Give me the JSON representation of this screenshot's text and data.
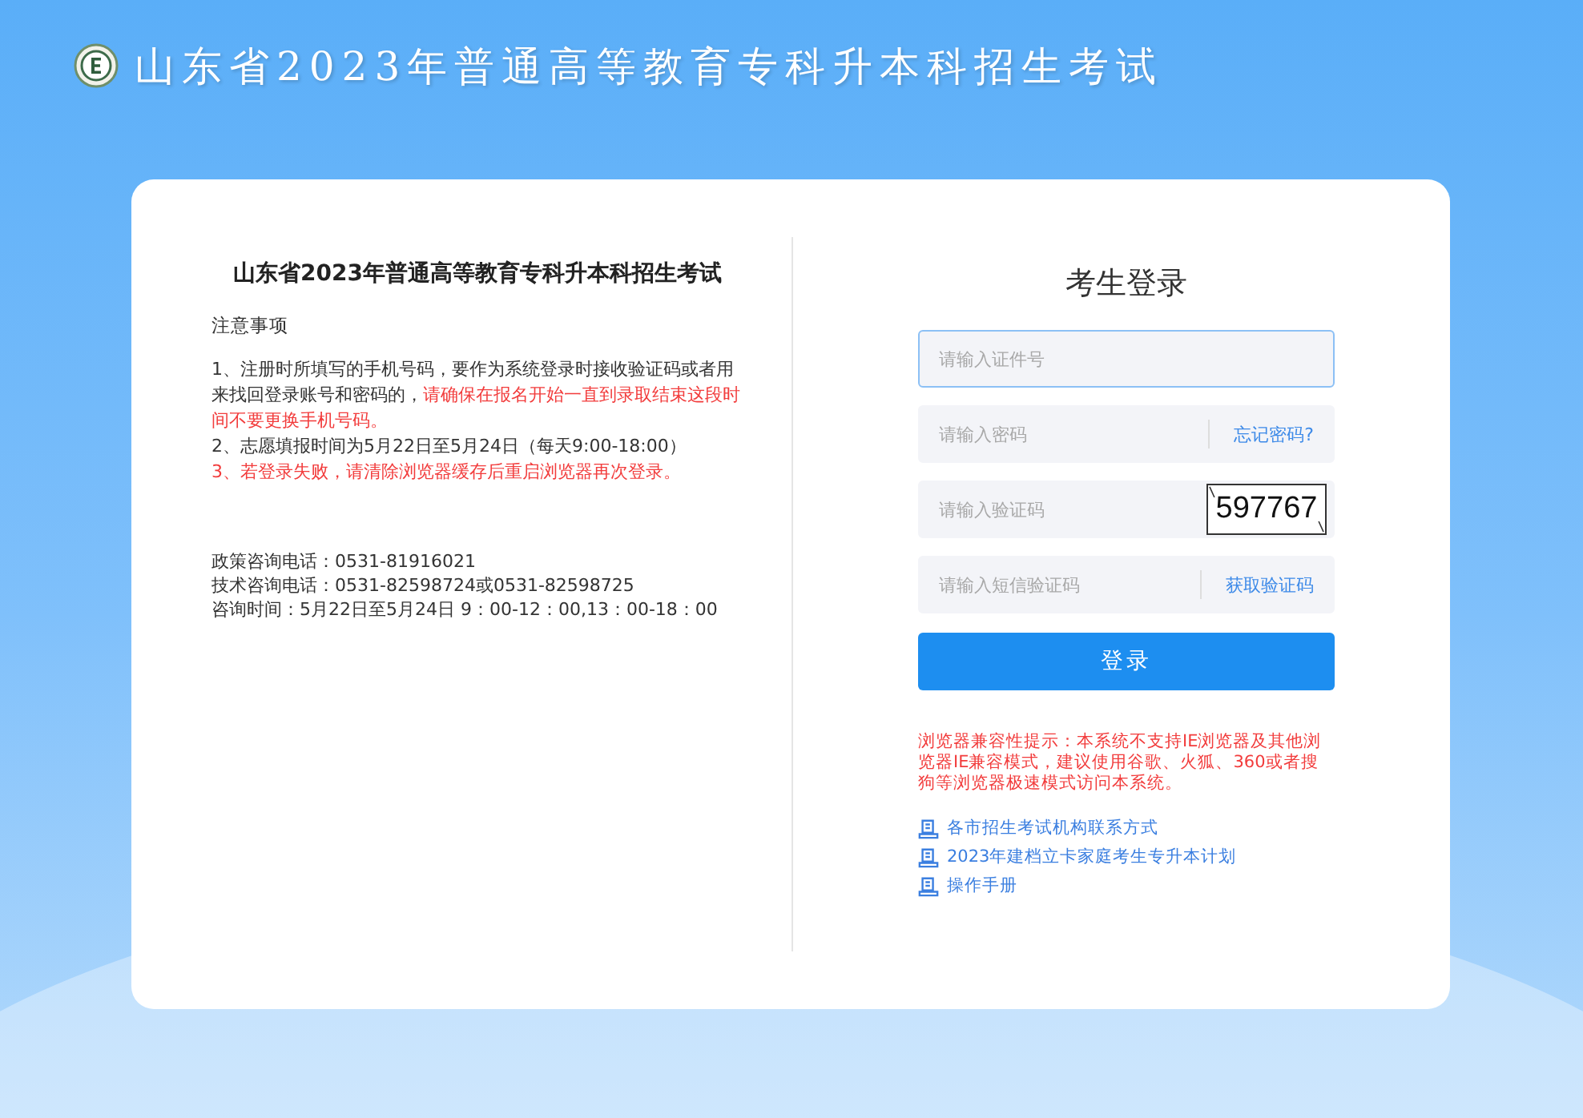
{
  "header": {
    "title": "山东省2023年普通高等教育专科升本科招生考试"
  },
  "notice": {
    "title": "山东省2023年普通高等教育专科升本科招生考试",
    "heading": "注意事项",
    "items": [
      {
        "segments": [
          {
            "text": "1、注册时所填写的手机号码，要作为系统登录时接收验证码或者用来找回登录账号和密码的，",
            "alert": false
          },
          {
            "text": "请确保在报名开始一直到录取结束这段时间不要更换手机号码。",
            "alert": true
          }
        ]
      },
      {
        "segments": [
          {
            "text": "2、志愿填报时间为5月22日至5月24日（每天9:00-18:00）",
            "alert": false
          }
        ]
      },
      {
        "segments": [
          {
            "text": "3、若登录失败，请清除浏览器缓存后重启浏览器再次登录。",
            "alert": true
          }
        ]
      }
    ],
    "contacts": [
      "政策咨询电话：0531-81916021",
      "技术咨询电话：0531-82598724或0531-82598725",
      "咨询时间：5月22日至5月24日 9：00-12：00,13：00-18：00"
    ]
  },
  "login": {
    "title": "考生登录",
    "fields": [
      {
        "kind": "plain",
        "placeholder": "请输入证件号",
        "focused": true
      },
      {
        "kind": "link",
        "placeholder": "请输入密码",
        "focused": false,
        "action": "忘记密码?"
      },
      {
        "kind": "captcha",
        "placeholder": "请输入验证码",
        "focused": false,
        "captcha": "597767"
      },
      {
        "kind": "link",
        "placeholder": "请输入短信验证码",
        "focused": false,
        "action": "获取验证码"
      }
    ],
    "submit": "登录",
    "compat_notice": "浏览器兼容性提示：本系统不支持IE浏览器及其他浏览器IE兼容模式，建议使用谷歌、火狐、360或者搜狗等浏览器极速模式访问本系统。",
    "links": [
      "各市招生考试机构联系方式",
      "2023年建档立卡家庭考生专升本计划",
      "操作手册"
    ]
  }
}
